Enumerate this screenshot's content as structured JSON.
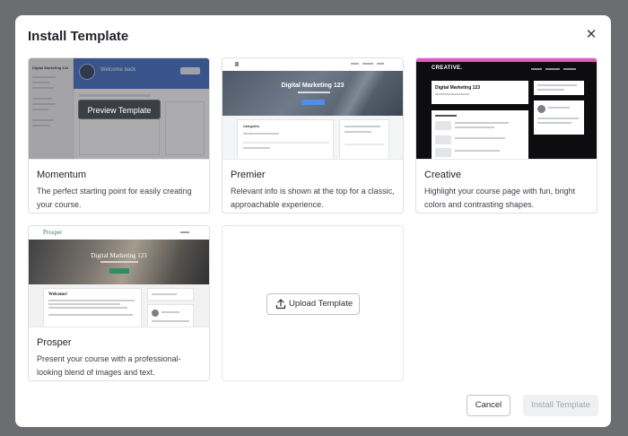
{
  "modal": {
    "title": "Install Template",
    "close_icon": "close-icon"
  },
  "templates": [
    {
      "name": "Momentum",
      "description": "The perfect starting point for easily creating your course.",
      "preview_label": "Preview Template",
      "thumb": {
        "site_title": "Digital Marketing 123",
        "welcome": "Welcome back"
      }
    },
    {
      "name": "Premier",
      "description": "Relevant info is shown at the top for a classic, approachable experience.",
      "thumb": {
        "hero_title": "Digital Marketing 123",
        "section": "Categories"
      }
    },
    {
      "name": "Creative",
      "description": "Highlight your course page with fun, bright colors and contrasting shapes.",
      "thumb": {
        "logo": "CREATIVE.",
        "hero_title": "Digital Marketing 123"
      }
    },
    {
      "name": "Prosper",
      "description": "Present your course with a professional-looking blend of images and text.",
      "thumb": {
        "logo": "Prosper",
        "hero_title": "Digital Marketing 123",
        "welcome": "Welcome!"
      }
    }
  ],
  "upload": {
    "label": "Upload Template",
    "icon": "upload-icon"
  },
  "footer": {
    "cancel_label": "Cancel",
    "install_label": "Install Template"
  },
  "colors": {
    "backdrop": "#6b6d70",
    "momentum_hero": "#2f5fbf",
    "creative_accent": "#e35ac7",
    "prosper_button": "#2f8e5f",
    "disabled_text": "#a3a8ae"
  }
}
